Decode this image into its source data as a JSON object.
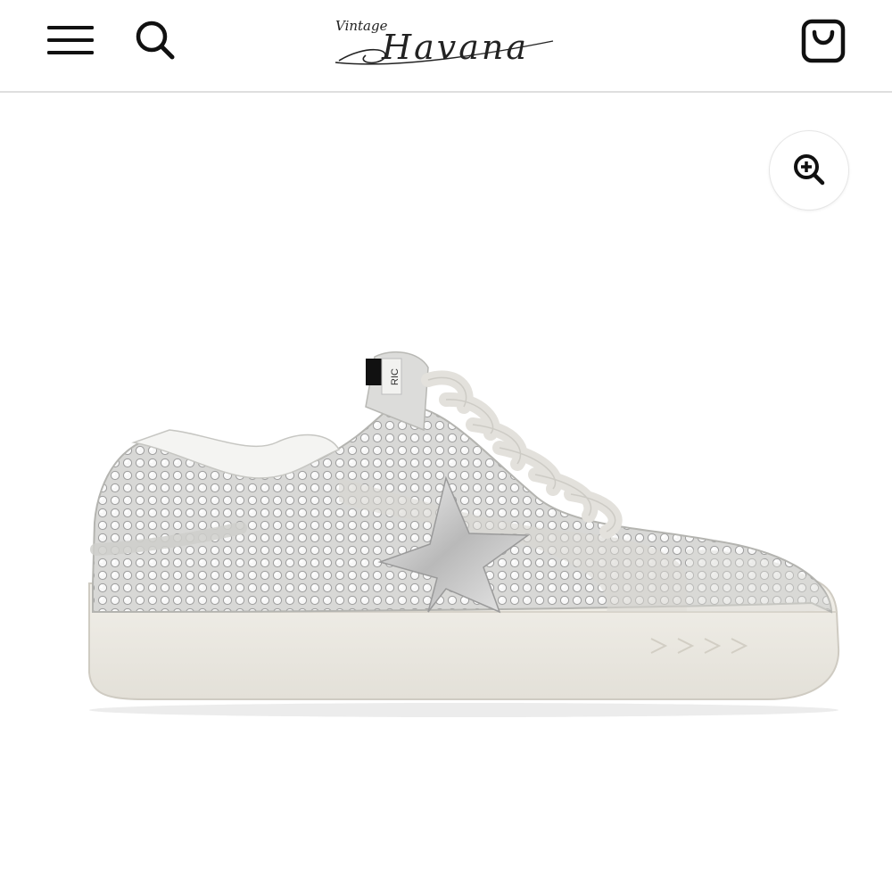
{
  "header": {
    "menu_icon": "hamburger-menu-icon",
    "search_icon": "search-icon",
    "logo": {
      "small_text": "Vintage",
      "main_text": "Havana"
    },
    "cart_icon": "shopping-bag-icon"
  },
  "product": {
    "zoom_icon": "zoom-in-icon",
    "image_subject": "rhinestone-sneaker",
    "tongue_label": "RIC"
  },
  "colors": {
    "text": "#111111",
    "divider": "#dedede",
    "background": "#ffffff"
  }
}
